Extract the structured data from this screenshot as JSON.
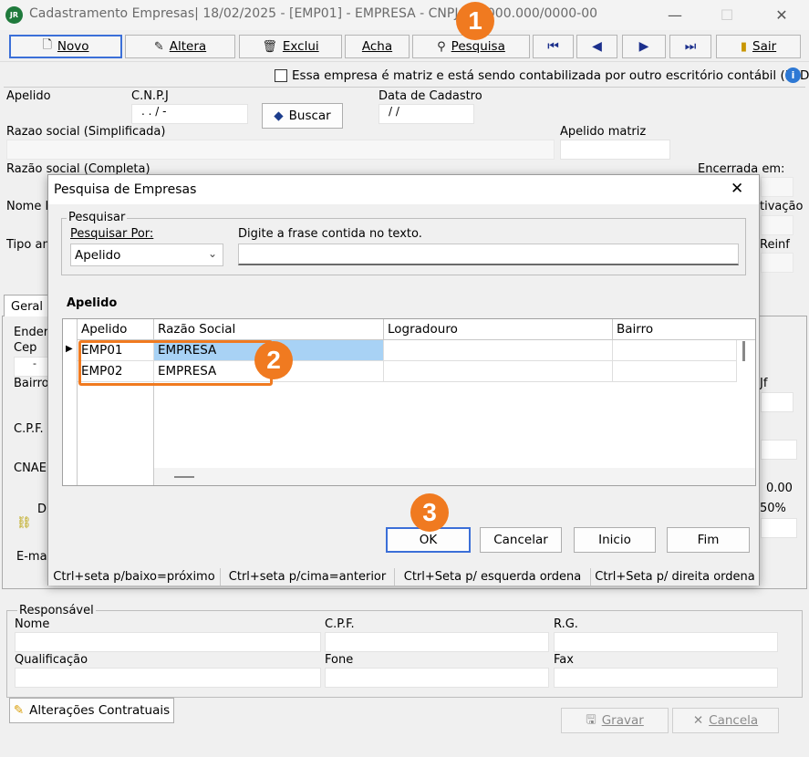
{
  "window": {
    "title": "Cadastramento Empresas|  18/02/2025 - [EMP01] - EMPRESA - CNPJ: 00.000.000/0000-00",
    "app_icon": "JR",
    "minimize": "—",
    "maximize": "☐",
    "close": "✕"
  },
  "toolbar": {
    "novo": "Novo",
    "altera": "Altera",
    "exclui": "Exclui",
    "acha": "Acha",
    "pesquisa": "Pesquisa",
    "first": "⏮",
    "prev": "◀",
    "next": "▶",
    "last": "⏭",
    "sair": "Sair"
  },
  "matrix_checkbox_label": "Essa empresa é matriz e está sendo contabilizada por outro escritório contábil (EFD-Reinf",
  "form": {
    "apelido": "Apelido",
    "cnpj": "C.N.P.J",
    "cnpj_mask": " .  .  /  -",
    "buscar": "Buscar",
    "data_cadastro": "Data de Cadastro",
    "data_mask": " /  /",
    "razao_simplificada": "Razao social (Simplificada)",
    "apelido_matriz": "Apelido matriz",
    "razao_completa": "Razão social (Completa)",
    "encerrada": "Encerrada em:",
    "nome_f": "Nome F",
    "ativacao": "tivação",
    "tipo_am": "Tipo am",
    "reinf": "Reinf",
    "tab_geral": "Geral",
    "ender": "Ender",
    "cep": "Cep",
    "cep_mask": "-",
    "bairro": "Bairro",
    "uf": "Jf",
    "cpf": "C.P.F.",
    "cnae": "CNAE",
    "value_000": "0.00",
    "pct": "50%",
    "di": "Di",
    "email": "E-mai",
    "responsavel": "Responsável",
    "resp_nome": "Nome",
    "resp_cpf": "C.P.F.",
    "resp_rg": "R.G.",
    "qualificacao": "Qualificação",
    "fone": "Fone",
    "fax": "Fax",
    "alteracoes": "Alterações Contratuais",
    "gravar": "Gravar",
    "cancela": "Cancela"
  },
  "dialog": {
    "title": "Pesquisa de Empresas",
    "close": "✕",
    "group_label": "Pesquisar",
    "pesquisar_por": "Pesquisar Por:",
    "select_value": "Apelido",
    "digite_label": "Digite a frase contida no texto.",
    "digite_value": "",
    "grid_caption": "Apelido",
    "columns": [
      "Apelido",
      "Razão Social",
      "Logradouro",
      "Bairro"
    ],
    "rows": [
      {
        "apelido": "EMP01",
        "razao": "EMPRESA",
        "logradouro": "",
        "bairro": ""
      },
      {
        "apelido": "EMP02",
        "razao": "EMPRESA",
        "logradouro": "",
        "bairro": ""
      }
    ],
    "ok": "OK",
    "cancelar": "Cancelar",
    "inicio": "Inicio",
    "fim": "Fim",
    "status": [
      "Ctrl+seta p/baixo=próximo",
      "Ctrl+seta p/cima=anterior",
      "Ctrl+Seta p/ esquerda ordena",
      "Ctrl+Seta p/ direita ordena"
    ]
  },
  "annotations": {
    "badge1": "1",
    "badge2": "2",
    "badge3": "3"
  },
  "colors": {
    "accent": "#f07a20",
    "selection": "#a8d2f5",
    "focus": "#3b6fd8"
  }
}
